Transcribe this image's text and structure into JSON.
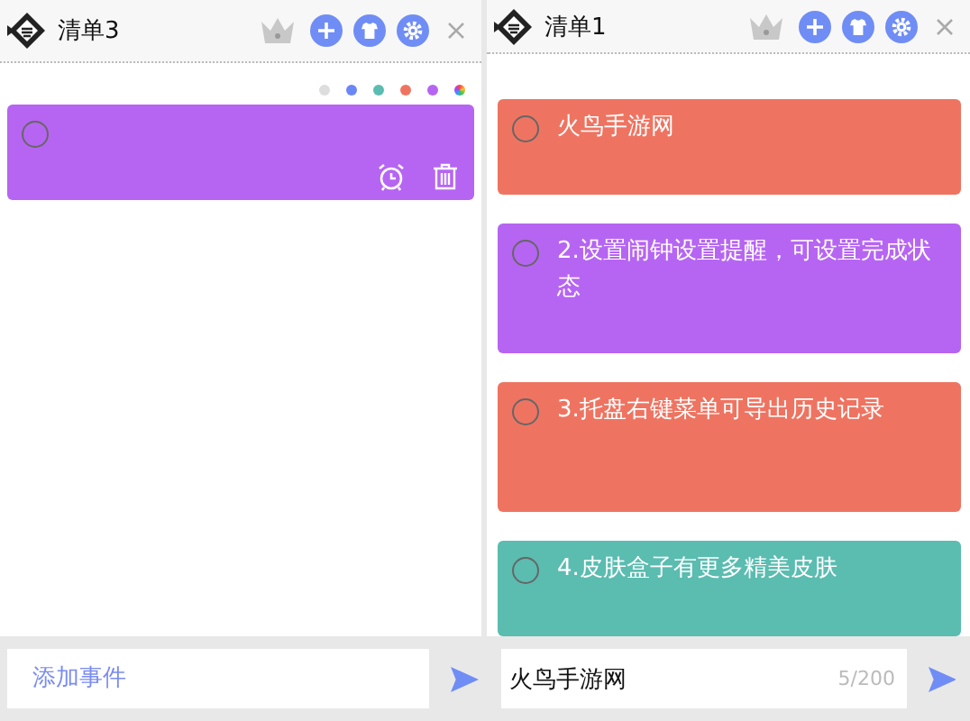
{
  "panels": [
    {
      "title": "清单3",
      "color_options": [
        {
          "color": "#dddddd"
        },
        {
          "color": "#6b87f5"
        },
        {
          "color": "#5bbcb0"
        },
        {
          "color": "#ee7461"
        },
        {
          "color": "#b665f2"
        },
        {
          "kind": "wheel"
        }
      ],
      "notes": [
        {
          "color": "#b665f2",
          "done": false,
          "show_actions": true
        }
      ],
      "input": {
        "placeholder": "添加事件"
      }
    },
    {
      "title": "清单1",
      "notes": [
        {
          "text": "火鸟手游网",
          "color": "#ee7461",
          "done": false,
          "show_actions": false
        },
        {
          "text": "2.设置闹钟设置提醒，可设置完成状态",
          "color": "#b665f2",
          "done": false,
          "show_actions": false
        },
        {
          "text": "3.托盘右键菜单可导出历史记录",
          "color": "#ee7461",
          "done": false,
          "show_actions": false
        },
        {
          "text": "4.皮肤盒子有更多精美皮肤",
          "color": "#5bbcb0",
          "done": false,
          "show_actions": false
        }
      ],
      "input": {
        "value": "火鸟手游网",
        "counter": "5/200"
      }
    }
  ]
}
